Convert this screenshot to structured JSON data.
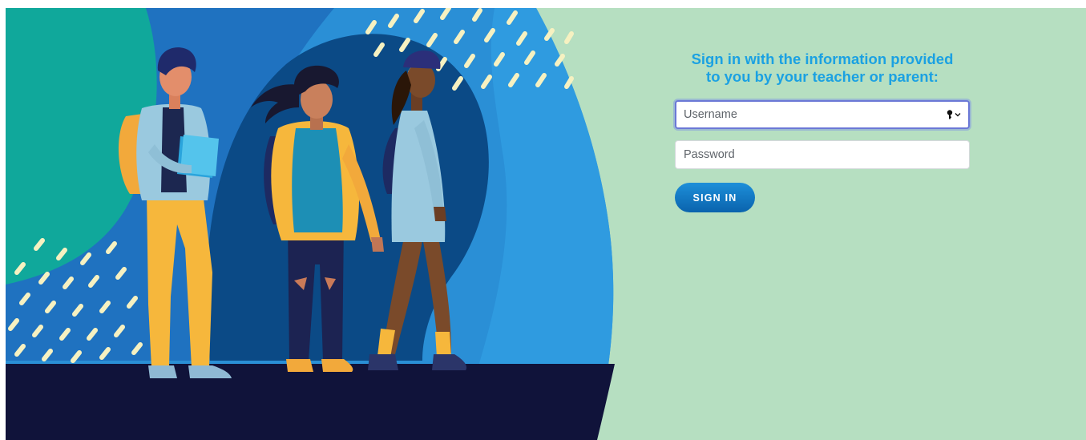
{
  "login": {
    "heading_line1": "Sign in with the information provided",
    "heading_line2": "to you by your teacher or parent:",
    "username_placeholder": "Username",
    "password_placeholder": "Password",
    "signin_label": "SIGN IN",
    "password_manager_icon": "key-dropdown-icon"
  },
  "colors": {
    "page_background": "#b6dfc1",
    "heading": "#1ba1e2",
    "button": "#0a6fb8",
    "focus_ring": "#6b78d6",
    "floor": "#10133a"
  }
}
